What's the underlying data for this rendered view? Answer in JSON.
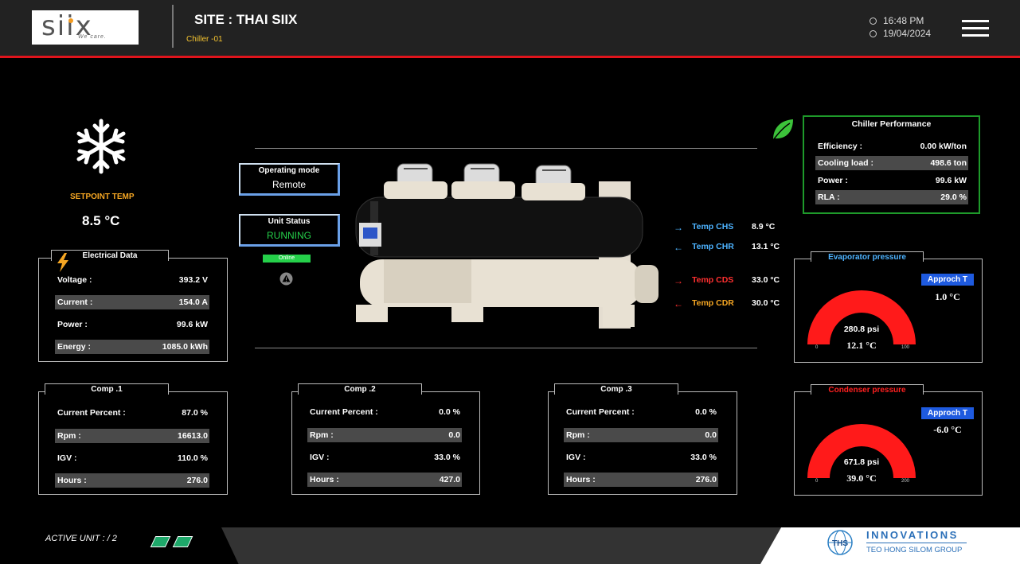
{
  "header": {
    "logo_text": "siix",
    "logo_tag": "We care.",
    "site_title": "SITE : THAI SIIX",
    "chiller_name": "Chiller -01",
    "time": "16:48 PM",
    "date": "19/04/2024"
  },
  "setpoint": {
    "label": "SETPOINT TEMP",
    "value": "8.5 °C"
  },
  "electrical": {
    "title": "Electrical Data",
    "rows": [
      {
        "label": "Voltage :",
        "value": "393.2 V"
      },
      {
        "label": "Current :",
        "value": "154.0 A"
      },
      {
        "label": "Power :",
        "value": "99.6 kW"
      },
      {
        "label": "Energy :",
        "value": "1085.0 kWh"
      }
    ]
  },
  "operating_mode": {
    "title": "Operating mode",
    "value": "Remote"
  },
  "unit_status": {
    "title": "Unit Status",
    "value": "RUNNING",
    "online_label": "Online",
    "status_color": "#25d04a"
  },
  "temps": [
    {
      "name": "Temp CHS",
      "value": "8.9 °C",
      "color": "#4db3ff",
      "arrow_color": "#4db3ff",
      "arrow": "→"
    },
    {
      "name": "Temp CHR",
      "value": "13.1 °C",
      "color": "#4db3ff",
      "arrow_color": "#4db3ff",
      "arrow": "←"
    },
    {
      "name": "Temp CDS",
      "value": "33.0 °C",
      "color": "#ff3030",
      "arrow_color": "#ff3030",
      "arrow": "→"
    },
    {
      "name": "Temp CDR",
      "value": "30.0 °C",
      "color": "#f5a623",
      "arrow_color": "#ff3030",
      "arrow": "←"
    }
  ],
  "performance": {
    "title": "Chiller Performance",
    "rows": [
      {
        "label": "Efficiency :",
        "value": "0.00 kW/ton"
      },
      {
        "label": "Cooling load :",
        "value": "498.6 ton"
      },
      {
        "label": "Power :",
        "value": "99.6 kW"
      },
      {
        "label": "RLA :",
        "value": "29.0 %"
      }
    ]
  },
  "evaporator": {
    "title": "Evaporator pressure",
    "title_color": "#4db3ff",
    "approch_label": "Approch T",
    "approch_value": "1.0 °C",
    "pressure": "280.8 psi",
    "temp": "12.1 °C",
    "min": "0",
    "max": "100"
  },
  "condenser": {
    "title": "Condenser pressure",
    "title_color": "#ff2020",
    "approch_label": "Approch T",
    "approch_value": "-6.0 °C",
    "pressure": "671.8 psi",
    "temp": "39.0 °C",
    "min": "0",
    "max": "200"
  },
  "comps": [
    {
      "title": "Comp .1",
      "rows": [
        {
          "label": "Current Percent :",
          "value": "87.0 %"
        },
        {
          "label": "Rpm :",
          "value": "16613.0"
        },
        {
          "label": "IGV :",
          "value": "110.0 %"
        },
        {
          "label": "Hours :",
          "value": "276.0"
        }
      ]
    },
    {
      "title": "Comp .2",
      "rows": [
        {
          "label": "Current Percent :",
          "value": "0.0 %"
        },
        {
          "label": "Rpm :",
          "value": "0.0"
        },
        {
          "label": "IGV :",
          "value": "33.0 %"
        },
        {
          "label": "Hours :",
          "value": "427.0"
        }
      ]
    },
    {
      "title": "Comp .3",
      "rows": [
        {
          "label": "Current Percent :",
          "value": "0.0 %"
        },
        {
          "label": "Rpm :",
          "value": "0.0"
        },
        {
          "label": "IGV :",
          "value": "33.0 %"
        },
        {
          "label": "Hours :",
          "value": "276.0"
        }
      ]
    }
  ],
  "footer": {
    "active_unit": "ACTIVE UNIT : / 2",
    "brand_initials": "THS",
    "brand_name": "INNOVATIONS",
    "brand_sub": "TEO HONG SILOM GROUP"
  },
  "colors": {
    "accent_red": "#e0141c",
    "perf_border": "#1e9a2a",
    "setpoint_label": "#f5a623",
    "gauge_fill": "#ff1a1a"
  }
}
